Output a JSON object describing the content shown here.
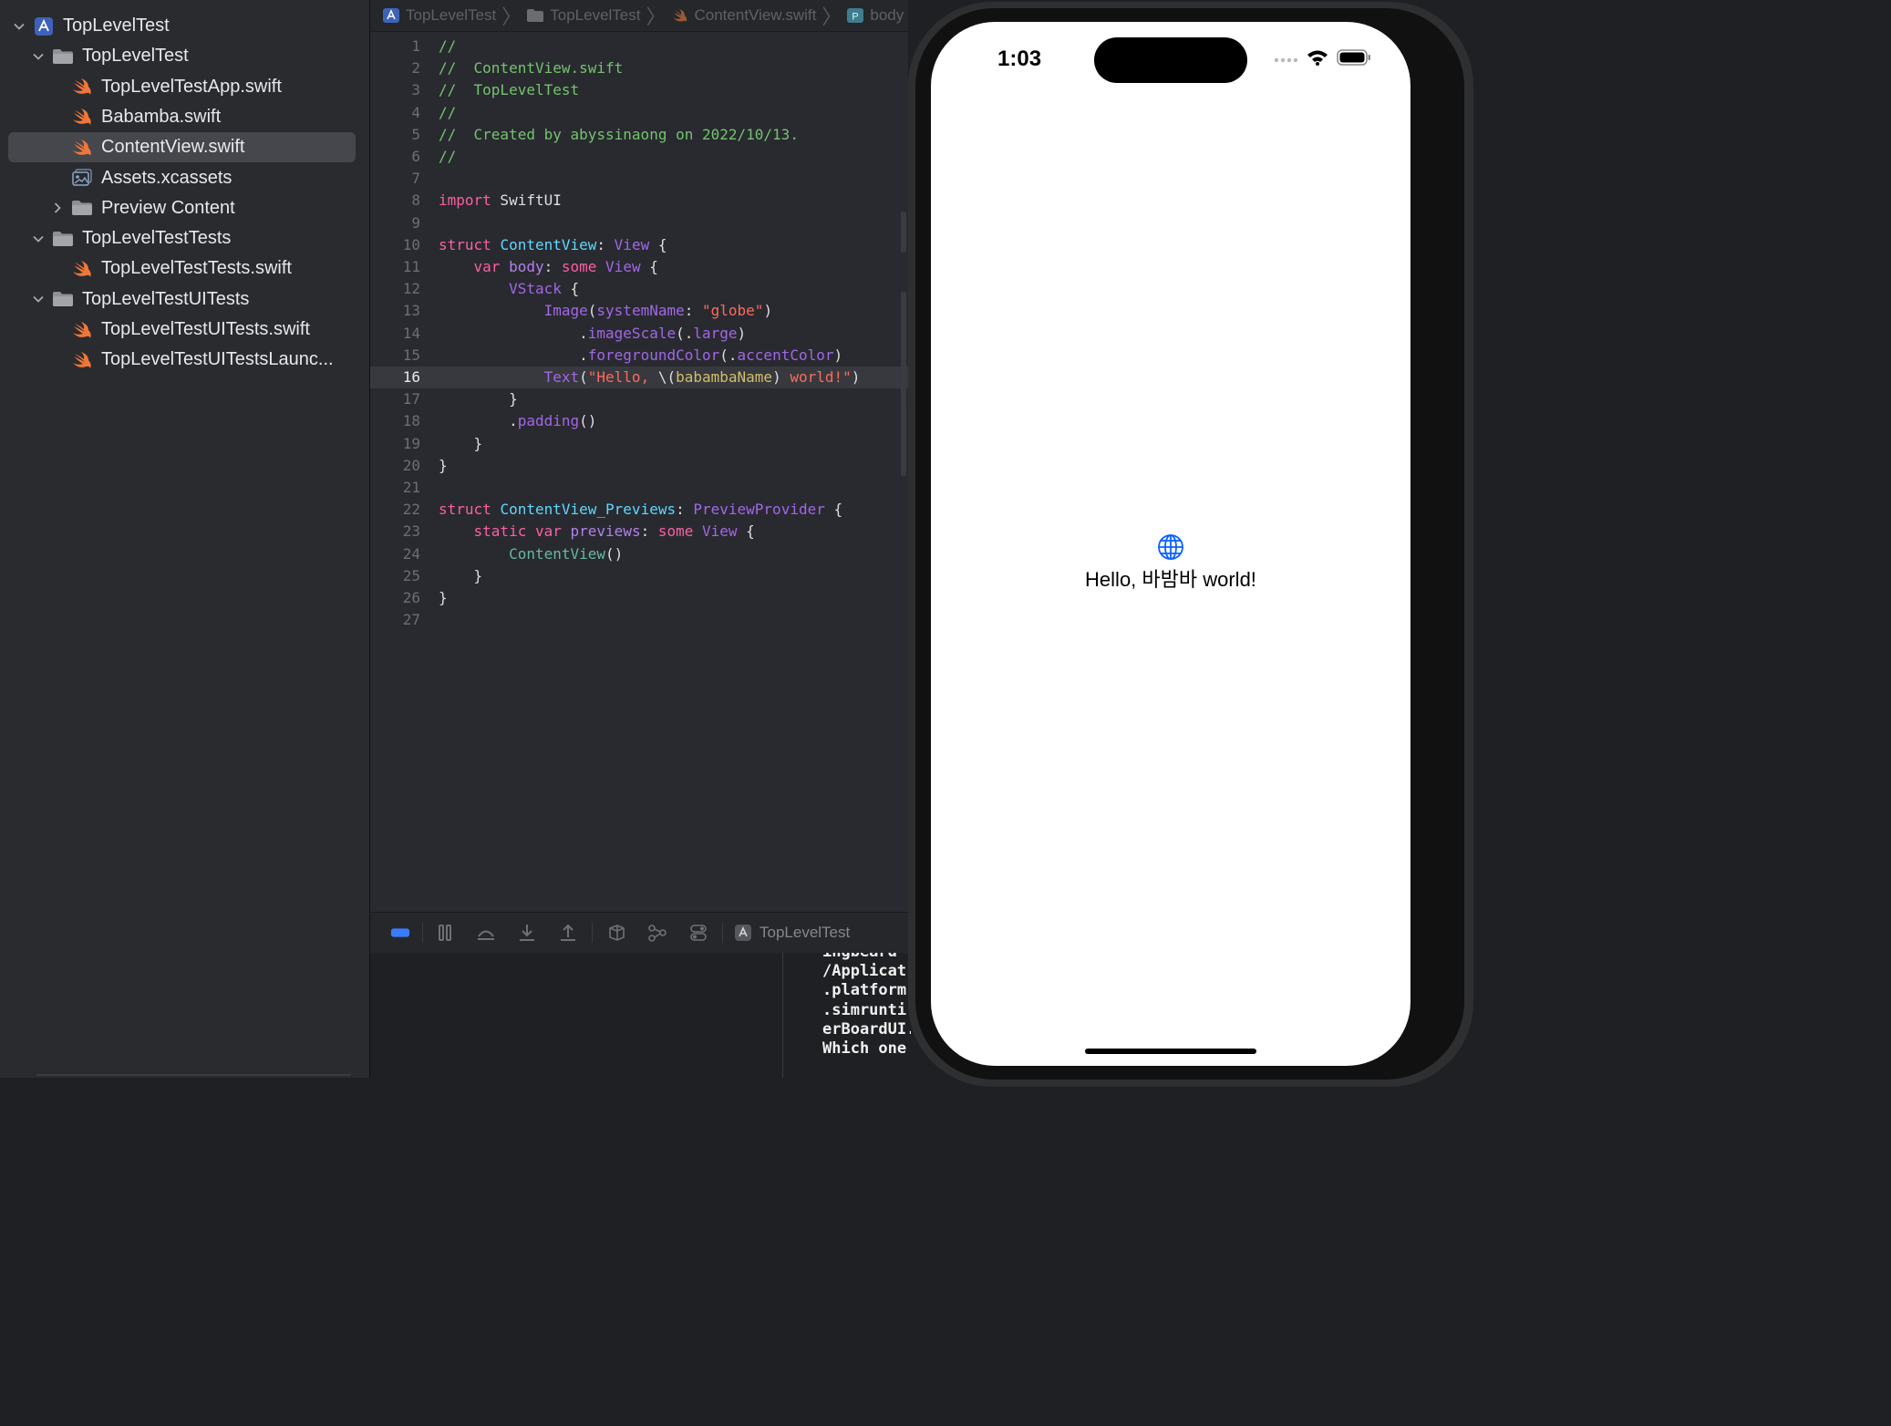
{
  "navigator": {
    "items": [
      {
        "label": "TopLevelTest",
        "kind": "project",
        "indent": 0,
        "disclosure": "open",
        "selected": false
      },
      {
        "label": "TopLevelTest",
        "kind": "folder",
        "indent": 1,
        "disclosure": "open",
        "selected": false
      },
      {
        "label": "TopLevelTestApp.swift",
        "kind": "swift",
        "indent": 2,
        "disclosure": "none",
        "selected": false
      },
      {
        "label": "Babamba.swift",
        "kind": "swift",
        "indent": 2,
        "disclosure": "none",
        "selected": false
      },
      {
        "label": "ContentView.swift",
        "kind": "swift",
        "indent": 2,
        "disclosure": "none",
        "selected": true
      },
      {
        "label": "Assets.xcassets",
        "kind": "assets",
        "indent": 2,
        "disclosure": "none",
        "selected": false
      },
      {
        "label": "Preview Content",
        "kind": "folder",
        "indent": 2,
        "disclosure": "closed",
        "selected": false
      },
      {
        "label": "TopLevelTestTests",
        "kind": "folder",
        "indent": 1,
        "disclosure": "open",
        "selected": false
      },
      {
        "label": "TopLevelTestTests.swift",
        "kind": "swift",
        "indent": 2,
        "disclosure": "none",
        "selected": false
      },
      {
        "label": "TopLevelTestUITests",
        "kind": "folder",
        "indent": 1,
        "disclosure": "open",
        "selected": false
      },
      {
        "label": "TopLevelTestUITests.swift",
        "kind": "swift",
        "indent": 2,
        "disclosure": "none",
        "selected": false
      },
      {
        "label": "TopLevelTestUITestsLaunc...",
        "kind": "swift",
        "indent": 2,
        "disclosure": "none",
        "selected": false
      }
    ]
  },
  "jumpbar": {
    "crumbs": [
      {
        "label": "TopLevelTest",
        "icon": "project-icon"
      },
      {
        "label": "TopLevelTest",
        "icon": "folder-icon"
      },
      {
        "label": "ContentView.swift",
        "icon": "swift-file-icon"
      },
      {
        "label": "body",
        "icon": "property-icon"
      }
    ],
    "property_badge": "P"
  },
  "editor": {
    "current_line": 16,
    "lines": [
      {
        "n": "1",
        "tokens": [
          [
            "c",
            "//"
          ]
        ]
      },
      {
        "n": "2",
        "tokens": [
          [
            "c",
            "//  ContentView.swift"
          ]
        ]
      },
      {
        "n": "3",
        "tokens": [
          [
            "c",
            "//  TopLevelTest"
          ]
        ]
      },
      {
        "n": "4",
        "tokens": [
          [
            "c",
            "//"
          ]
        ]
      },
      {
        "n": "5",
        "tokens": [
          [
            "c",
            "//  Created by abyssinaong on 2022/10/13."
          ]
        ]
      },
      {
        "n": "6",
        "tokens": [
          [
            "c",
            "//"
          ]
        ]
      },
      {
        "n": "7",
        "tokens": []
      },
      {
        "n": "8",
        "tokens": [
          [
            "k",
            "import"
          ],
          [
            "n",
            " SwiftUI"
          ]
        ]
      },
      {
        "n": "9",
        "tokens": []
      },
      {
        "n": "10",
        "tokens": [
          [
            "k",
            "struct"
          ],
          [
            "n",
            " "
          ],
          [
            "t",
            "ContentView"
          ],
          [
            "n",
            ": "
          ],
          [
            "tp",
            "View"
          ],
          [
            "n",
            " {"
          ]
        ]
      },
      {
        "n": "11",
        "tokens": [
          [
            "n",
            "    "
          ],
          [
            "k",
            "var"
          ],
          [
            "n",
            " "
          ],
          [
            "m",
            "body"
          ],
          [
            "n",
            ": "
          ],
          [
            "k",
            "some"
          ],
          [
            "n",
            " "
          ],
          [
            "tp",
            "View"
          ],
          [
            "n",
            " {"
          ]
        ]
      },
      {
        "n": "12",
        "tokens": [
          [
            "n",
            "        "
          ],
          [
            "tp",
            "VStack"
          ],
          [
            "n",
            " {"
          ]
        ]
      },
      {
        "n": "13",
        "tokens": [
          [
            "n",
            "            "
          ],
          [
            "tp",
            "Image"
          ],
          [
            "n",
            "("
          ],
          [
            "tp",
            "systemName"
          ],
          [
            "n",
            ": "
          ],
          [
            "s",
            "\"globe\""
          ],
          [
            "n",
            ")"
          ]
        ]
      },
      {
        "n": "14",
        "tokens": [
          [
            "n",
            "                ."
          ],
          [
            "tp",
            "imageScale"
          ],
          [
            "n",
            "(."
          ],
          [
            "tp",
            "large"
          ],
          [
            "n",
            ")"
          ]
        ]
      },
      {
        "n": "15",
        "tokens": [
          [
            "n",
            "                ."
          ],
          [
            "tp",
            "foregroundColor"
          ],
          [
            "n",
            "(."
          ],
          [
            "tp",
            "accentColor"
          ],
          [
            "n",
            ")"
          ]
        ]
      },
      {
        "n": "16",
        "tokens": [
          [
            "n",
            "            "
          ],
          [
            "tp",
            "Text"
          ],
          [
            "n",
            "("
          ],
          [
            "s",
            "\"Hello, "
          ],
          [
            "n",
            "\\("
          ],
          [
            "i",
            "babambaName"
          ],
          [
            "n",
            ")"
          ],
          [
            "s",
            " world!\""
          ],
          [
            "n",
            ")"
          ]
        ]
      },
      {
        "n": "17",
        "tokens": [
          [
            "n",
            "        }"
          ]
        ]
      },
      {
        "n": "18",
        "tokens": [
          [
            "n",
            "        ."
          ],
          [
            "tp",
            "padding"
          ],
          [
            "n",
            "()"
          ]
        ]
      },
      {
        "n": "19",
        "tokens": [
          [
            "n",
            "    }"
          ]
        ]
      },
      {
        "n": "20",
        "tokens": [
          [
            "n",
            "}"
          ]
        ]
      },
      {
        "n": "21",
        "tokens": []
      },
      {
        "n": "22",
        "tokens": [
          [
            "k",
            "struct"
          ],
          [
            "n",
            " "
          ],
          [
            "t",
            "ContentView_Previews"
          ],
          [
            "n",
            ": "
          ],
          [
            "tp",
            "PreviewProvider"
          ],
          [
            "n",
            " {"
          ]
        ]
      },
      {
        "n": "23",
        "tokens": [
          [
            "n",
            "    "
          ],
          [
            "k",
            "static"
          ],
          [
            "n",
            " "
          ],
          [
            "k",
            "var"
          ],
          [
            "n",
            " "
          ],
          [
            "m",
            "previews"
          ],
          [
            "n",
            ": "
          ],
          [
            "k",
            "some"
          ],
          [
            "n",
            " "
          ],
          [
            "tp",
            "View"
          ],
          [
            "n",
            " {"
          ]
        ]
      },
      {
        "n": "24",
        "tokens": [
          [
            "n",
            "        "
          ],
          [
            "f",
            "ContentView"
          ],
          [
            "n",
            "()"
          ]
        ]
      },
      {
        "n": "25",
        "tokens": [
          [
            "n",
            "    }"
          ]
        ]
      },
      {
        "n": "26",
        "tokens": [
          [
            "n",
            "}"
          ]
        ]
      },
      {
        "n": "27",
        "tokens": []
      }
    ]
  },
  "debugbar": {
    "target": "TopLevelTest"
  },
  "console": {
    "lines": [
      "ingbeard",
      "/Applicat",
      ".platform",
      ".simrunti",
      "erBoardUI.",
      "Which one i"
    ]
  },
  "simulator": {
    "time": "1:03",
    "hello_text": "Hello, 바밤바 world!",
    "accent_color": "#0a60ff"
  },
  "colors": {
    "comment": "#73c46d",
    "keyword": "#fc5fa3",
    "type": "#5dd8ff",
    "string": "#fc6a5d",
    "swift_icon": "#f0773a"
  }
}
